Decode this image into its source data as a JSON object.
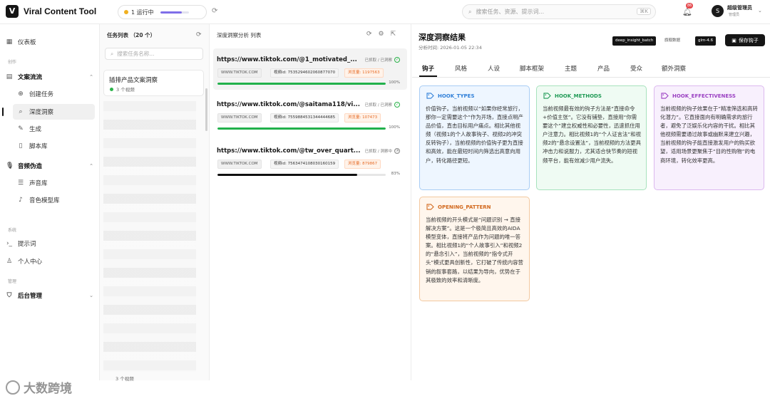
{
  "app": {
    "title": "Viral Content Tool",
    "logo_letter": "V"
  },
  "topbar": {
    "run_status": "1 运行中",
    "run_progress": 0.75,
    "search_placeholder": "搜索任务、资源、提示词...",
    "search_shortcut": "⌘K",
    "notifications": "86",
    "user_initial": "S",
    "user_name": "超级管理员",
    "user_role": "管理员"
  },
  "sidebar": {
    "dashboard": "仪表板",
    "section_create": "创作",
    "group_copy": "文案流流",
    "create_task": "创建任务",
    "deep_insight": "深度洞察",
    "generate": "生成",
    "script_lib": "脚本库",
    "group_audio": "音频伪造",
    "voice_lib": "声音库",
    "voice_model_lib": "音色模型库",
    "section_tools": "系统",
    "prompts": "提示词",
    "personal_center": "个人中心",
    "section_manage": "管理",
    "admin": "后台管理"
  },
  "task_list": {
    "header": "任务列表 （20 个）",
    "search_placeholder": "搜索任务名称...",
    "selected_title": "插排产品文案洞察",
    "selected_sub": "3 个视频",
    "footer_sub": "3 个视频"
  },
  "analysis": {
    "header": "深度洞察分析 列表",
    "items": [
      {
        "url": "https://www.tiktok.com/@1_motivated_...",
        "status": "已抓取 / 已洞察",
        "site": "WWW.TIKTOK.COM",
        "video_id": "视频id: 7535294602060877070",
        "views": "浏览量: 1197563",
        "progress": 100,
        "pct": "100%"
      },
      {
        "url": "https://www.tiktok.com/@saitama118/vi...",
        "status": "已抓取 / 已洞察",
        "site": "WWW.TIKTOK.COM",
        "video_id": "视频id: 7559884531344444685",
        "views": "浏览量: 107473",
        "progress": 100,
        "pct": "100%"
      },
      {
        "url": "https://www.tiktok.com/@tw_over_quart...",
        "status": "已抓取 / 洞察中",
        "site": "WWW.TIKTOK.COM",
        "video_id": "视频id: 7563474108030160159",
        "views": "浏览量: 879867",
        "progress": 83,
        "pct": "83%"
      }
    ]
  },
  "result": {
    "title": "深度洞察结果",
    "time": "分析时间: 2026-01-05 22:34",
    "badge_batch": "deep_insight_batch",
    "badge_batch_label": "旗舰数据",
    "badge_model": "glm-4.6",
    "save_label": "保存钩子",
    "tabs": [
      "钩子",
      "风格",
      "人设",
      "脚本框架",
      "主题",
      "产品",
      "受众",
      "额外洞察"
    ],
    "cards": [
      {
        "title": "HOOK_TYPES",
        "color": "#2f7fd8",
        "bg": "#eef6ff",
        "border": "#a8cdf5",
        "body": "价值钩子。当前视频以“如果你经常旅行，那你一定需要这个”作为开场，直接点明产品价值，直击目标用户痛点。相比其他视频（视频1的个人故事钩子、视频2的冲突反转钩子），当前视频的价值钩子更为直接和高效，能在最短时间内筛选出高意向用户，转化路径更短。"
      },
      {
        "title": "HOOK_METHODS",
        "color": "#1f9a55",
        "bg": "#effbf3",
        "border": "#a7e2bd",
        "body": "当前视频最有效的钩子方法是“直接命令+价值主张”。它没有铺垫，直接用“你需要这个”建立权威性和必要性，迅速抓住用户注意力。相比视频1的“个人证言法”和视频2的“悬念设置法”，当前视频的方法更具冲击力和说服力，尤其适合快节奏的短视频平台，能有效减少用户流失。"
      },
      {
        "title": "HOOK_EFFECTIVENESS",
        "color": "#9a3fc2",
        "bg": "#f8f0fd",
        "border": "#dcb8ef",
        "body": "当前视频的钩子效果在于“精准筛选和高转化潜力”。它直接面向有明确需求的旅行者，避免了泛娱乐化内容的干扰。相比其他视频需要通过故事或幽默来建立兴趣，当前视频的钩子能直接激发用户的购买欲望，适用场景更聚焦于“目的性购物”的电商环境，转化效率更高。"
      },
      {
        "title": "OPENING_PATTERN",
        "color": "#d2691e",
        "bg": "#fff6ed",
        "border": "#f3c9a0",
        "body": "当前视频的开头模式是“问题识别 → 直接解决方案”。这是一个极简且高效的AIDA模型变体，直接将产品作为问题的唯一答案。相比视频1的“个人故事引入”和视频2的“悬念引入”，当前视频的“指令式开头”模式更具创新性，它打破了传统内容营销的叙事套路，以结果为导向，优势在于其极致的效率和清晰度。"
      }
    ]
  },
  "watermark": {
    "brand": "大数跨境"
  }
}
